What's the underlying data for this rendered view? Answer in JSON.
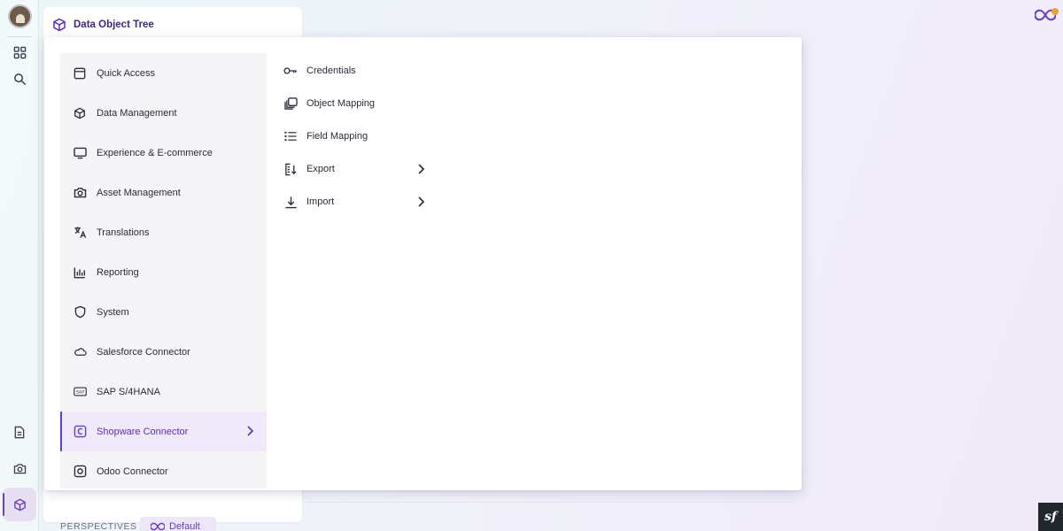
{
  "panel": {
    "title": "Data Object Tree"
  },
  "perspectives": {
    "label": "PERSPECTIVES",
    "current": "Default"
  },
  "menu": {
    "items": [
      {
        "label": "Quick Access",
        "icon": "window-icon"
      },
      {
        "label": "Data Management",
        "icon": "cube-icon"
      },
      {
        "label": "Experience & E-commerce",
        "icon": "monitor-icon"
      },
      {
        "label": "Asset Management",
        "icon": "camera-icon"
      },
      {
        "label": "Translations",
        "icon": "translate-icon"
      },
      {
        "label": "Reporting",
        "icon": "bar-chart-icon"
      },
      {
        "label": "System",
        "icon": "shield-icon"
      },
      {
        "label": "Salesforce Connector",
        "icon": "cloud-icon"
      },
      {
        "label": "SAP S/4HANA",
        "icon": "sap-icon"
      },
      {
        "label": "Shopware Connector",
        "icon": "shopware-icon",
        "active": true
      },
      {
        "label": "Odoo Connector",
        "icon": "odoo-icon"
      }
    ],
    "submenu": [
      {
        "label": "Credentials",
        "icon": "key-icon"
      },
      {
        "label": "Object Mapping",
        "icon": "copy-stack-icon"
      },
      {
        "label": "Field Mapping",
        "icon": "list-icon"
      },
      {
        "label": "Export",
        "icon": "export-icon",
        "has_children": true
      },
      {
        "label": "Import",
        "icon": "download-icon",
        "has_children": true
      }
    ]
  },
  "colors": {
    "accent": "#6a3fc2",
    "active_bg": "#efe9f9",
    "menu_bg": "#f5f5f7",
    "notification": "#f0a030"
  },
  "badge": {
    "text": "sf"
  }
}
